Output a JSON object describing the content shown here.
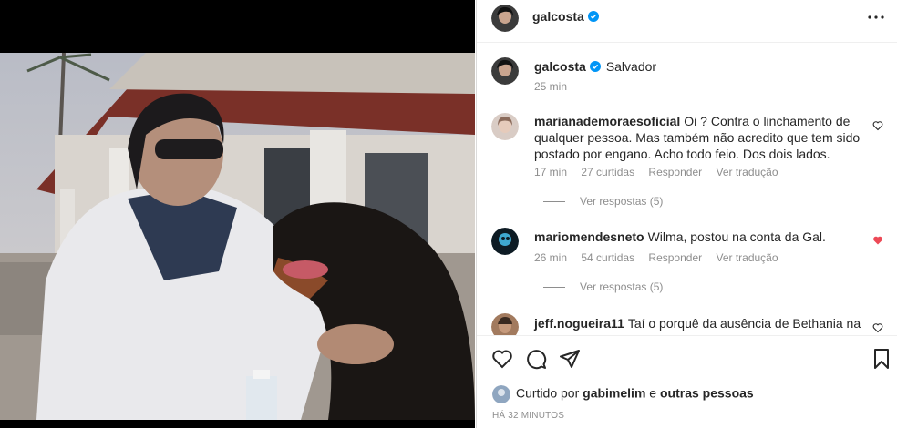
{
  "post": {
    "author": "galcosta",
    "location": "Salvador",
    "caption_time": "25 min"
  },
  "comments": [
    {
      "username": "marianademoraesoficial",
      "text": "Oi ? Contra o linchamento de qualquer pessoa. Mas também não acredito que tem sido postado por engano. Acho todo feio. Dos dois lados.",
      "time": "17 min",
      "likes": "27 curtidas",
      "reply_label": "Responder",
      "translate_label": "Ver tradução",
      "view_replies": "Ver respostas (5)",
      "liked": false
    },
    {
      "username": "mariomendesneto",
      "text": "Wilma, postou na conta da Gal.",
      "time": "26 min",
      "likes": "54 curtidas",
      "reply_label": "Responder",
      "translate_label": "Ver tradução",
      "view_replies": "Ver respostas (5)",
      "liked": true
    },
    {
      "username": "jeff.nogueira11",
      "text": "Taí o porquê da ausência de Bethania na",
      "liked": false
    }
  ],
  "liked_by": {
    "prefix": "Curtido por",
    "user": "gabimelim",
    "conjunction": "e",
    "others": "outras pessoas"
  },
  "timestamp": "HÁ 32 MINUTOS",
  "colors": {
    "accent_blue": "#0095f6",
    "like_red": "#ed4956",
    "muted": "#8e8e8e"
  },
  "icons": {
    "verified": "verified-badge-icon",
    "more": "more-options-icon",
    "like": "heart-icon",
    "comment": "comment-icon",
    "share": "share-icon",
    "save": "bookmark-icon"
  }
}
